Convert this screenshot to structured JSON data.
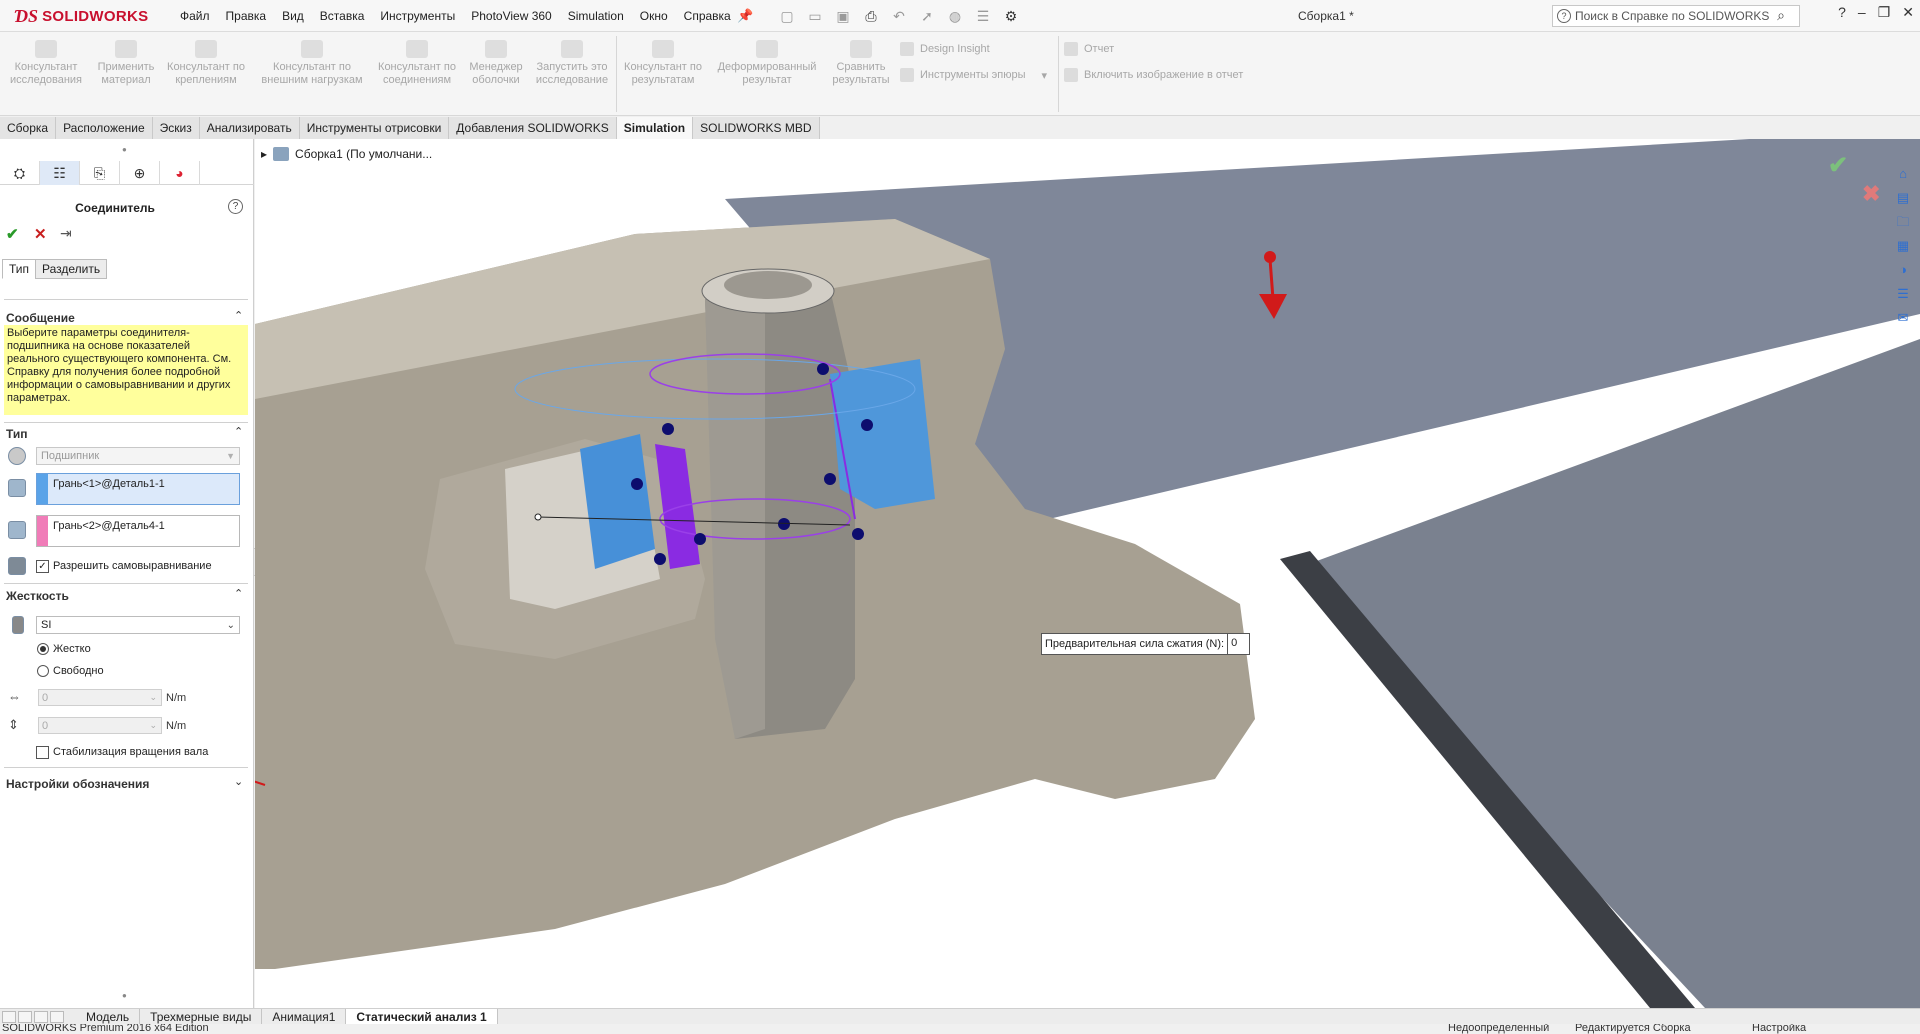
{
  "app": {
    "logo_text": "SOLIDWORKS",
    "document_title": "Сборка1 *",
    "help_search_placeholder": "Поиск в Справке по SOLIDWORKS"
  },
  "menu": [
    "Файл",
    "Правка",
    "Вид",
    "Вставка",
    "Инструменты",
    "PhotoView 360",
    "Simulation",
    "Окно",
    "Справка"
  ],
  "commands": {
    "study_advisor": "Консультант исследования",
    "apply_material": "Применить материал",
    "fixtures_advisor": "Консультант по креплениям",
    "external_loads_advisor": "Консультант по внешним нагрузкам",
    "connections_advisor": "Консультант по соединениям",
    "shell_manager": "Менеджер оболочки",
    "run_study": "Запустить это исследование",
    "results_advisor": "Консультант по результатам",
    "deformed_result": "Деформированный результат",
    "compare_results": "Сравнить результаты",
    "design_insight": "Design Insight",
    "plot_tools": "Инструменты эпюры",
    "report": "Отчет",
    "include_image": "Включить изображение в отчет"
  },
  "tabs": [
    "Сборка",
    "Расположение",
    "Эскиз",
    "Анализировать",
    "Инструменты отрисовки",
    "Добавления SOLIDWORKS",
    "Simulation",
    "SOLIDWORKS MBD"
  ],
  "active_tab": "Simulation",
  "property_manager": {
    "title": "Соединитель",
    "tab_type": "Тип",
    "tab_split": "Разделить",
    "message_header": "Сообщение",
    "message": "Выберите параметры соединителя-подшипника на основе показателей реального существующего компонента. См. Справку для получения более подробной информации о самовыравнивании и других параметрах.",
    "type_header": "Тип",
    "type_value": "Подшипник",
    "face1": "Грань<1>@Деталь1-1",
    "face2": "Грань<2>@Деталь4-1",
    "face1_color": "#5aa3e8",
    "face2_color": "#f07cb8",
    "allow_self_align": "Разрешить самовыравнивание",
    "allow_self_align_checked": true,
    "stiffness_header": "Жесткость",
    "units_value": "SI",
    "rigid": "Жестко",
    "free": "Свободно",
    "axial_value": "0",
    "radial_value": "0",
    "unit_label": "N/m",
    "stabilize_rotation": "Стабилизация вращения вала",
    "symbol_settings": "Настройки обозначения"
  },
  "viewport": {
    "tree_root": "Сборка1  (По умолчани...",
    "preload_label": "Предварительная сила сжатия (N):",
    "preload_value": "0",
    "force_arrow_color": "#d11a1a",
    "bearing_face_color": "#3f8fd6",
    "highlight_face_color": "#8a2be2"
  },
  "bottom_tabs": [
    "Модель",
    "Трехмерные виды",
    "Анимация1",
    "Статический анализ 1"
  ],
  "active_bottom_tab": "Статический анализ 1",
  "status": {
    "edition": "SOLIDWORKS Premium 2016 x64 Edition",
    "underdefined": "Недоопределенный",
    "editing": "Редактируется Сборка",
    "settings": "Настройка"
  }
}
